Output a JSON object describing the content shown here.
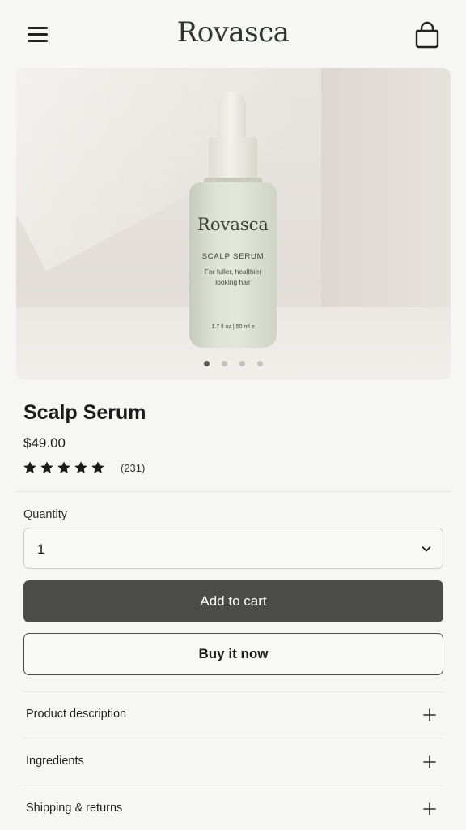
{
  "header": {
    "brand": "Rovasca"
  },
  "hero": {
    "bottle_brand": "Rovasca",
    "bottle_product": "SCALP SERUM",
    "bottle_desc_line1": "For fuller, healthier",
    "bottle_desc_line2": "looking hair",
    "bottle_volume": "1.7 fl oz | 50 ml e",
    "carousel_total": 4,
    "carousel_active": 1
  },
  "product": {
    "title": "Scalp Serum",
    "price": "$49.00",
    "rating": 5,
    "rating_max": 5,
    "review_count": "(231)"
  },
  "quantity": {
    "label": "Quantity",
    "value": "1"
  },
  "actions": {
    "add_to_cart": "Add to cart",
    "buy_now": "Buy it now"
  },
  "accordion": [
    {
      "label": "Product description"
    },
    {
      "label": "Ingredients"
    },
    {
      "label": "Shipping & returns"
    }
  ],
  "colors": {
    "background": "#f6f6f5",
    "primary_button": "#4b4b49",
    "text": "#1b1b1b"
  }
}
